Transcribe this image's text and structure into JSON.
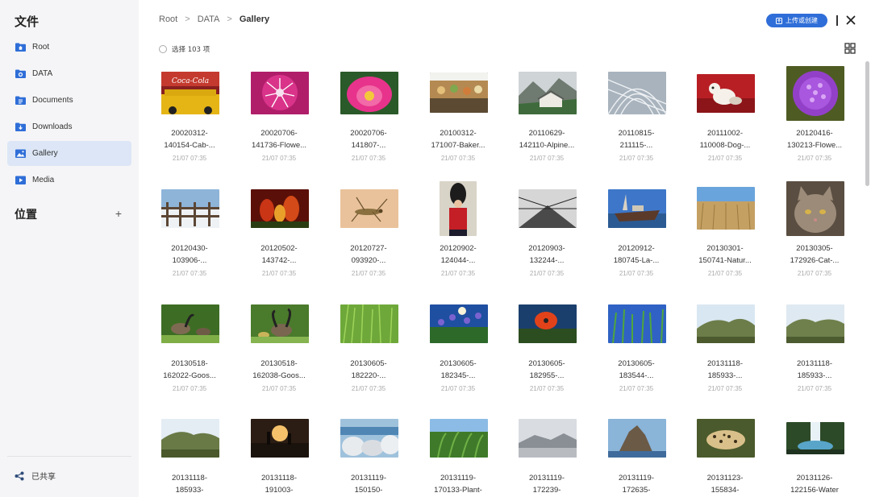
{
  "sidebar": {
    "title": "文件",
    "items": [
      {
        "label": "Root",
        "icon": "home-folder-icon"
      },
      {
        "label": "DATA",
        "icon": "data-folder-icon"
      },
      {
        "label": "Documents",
        "icon": "documents-folder-icon"
      },
      {
        "label": "Downloads",
        "icon": "downloads-folder-icon"
      },
      {
        "label": "Gallery",
        "icon": "gallery-icon"
      },
      {
        "label": "Media",
        "icon": "media-icon"
      }
    ],
    "location_title": "位置",
    "add_label": "+",
    "shared_label": "已共享"
  },
  "breadcrumb": {
    "items": [
      "Root",
      "DATA",
      "Gallery"
    ],
    "separator": ">"
  },
  "toolbar": {
    "upload_label": "上传或创建",
    "close_label": "close"
  },
  "select_all_label": "选择 103 项",
  "colors": {
    "accent": "#2f6ed8",
    "sidebar_bg": "#f5f5f7",
    "active_bg": "#dce6f6"
  },
  "items": [
    {
      "l1": "20020312-",
      "l2": "140154-Cab-...",
      "date": "21/07 07:35",
      "thumb": "taxi"
    },
    {
      "l1": "20020706-",
      "l2": "141736-Flowe...",
      "date": "21/07 07:35",
      "thumb": "pink-flower"
    },
    {
      "l1": "20020706-",
      "l2": "141807-...",
      "date": "21/07 07:35",
      "thumb": "lotus"
    },
    {
      "l1": "20100312-",
      "l2": "171007-Baker...",
      "date": "21/07 07:35",
      "thumb": "bakery"
    },
    {
      "l1": "20110629-",
      "l2": "142110-Alpine...",
      "date": "21/07 07:35",
      "thumb": "alpine"
    },
    {
      "l1": "20110815-",
      "l2": "211115-...",
      "date": "21/07 07:35",
      "thumb": "architecture"
    },
    {
      "l1": "20111002-",
      "l2": "110008-Dog-...",
      "date": "21/07 07:35",
      "thumb": "dog"
    },
    {
      "l1": "20120416-",
      "l2": "130213-Flowe...",
      "date": "21/07 07:35",
      "thumb": "purple-flower"
    },
    {
      "l1": "20120430-",
      "l2": "103906-...",
      "date": "21/07 07:35",
      "thumb": "snow-fence"
    },
    {
      "l1": "20120502-",
      "l2": "143742-...",
      "date": "21/07 07:35",
      "thumb": "tulips"
    },
    {
      "l1": "20120727-",
      "l2": "093920-...",
      "date": "21/07 07:35",
      "thumb": "grasshopper"
    },
    {
      "l1": "20120902-",
      "l2": "124044-...",
      "date": "21/07 07:35",
      "thumb": "guard"
    },
    {
      "l1": "20120903-",
      "l2": "132244-...",
      "date": "21/07 07:35",
      "thumb": "bridge"
    },
    {
      "l1": "20120912-",
      "l2": "180745-La-...",
      "date": "21/07 07:35",
      "thumb": "boat"
    },
    {
      "l1": "20130301-",
      "l2": "150741-Natur...",
      "date": "21/07 07:35",
      "thumb": "field"
    },
    {
      "l1": "20130305-",
      "l2": "172926-Cat-...",
      "date": "21/07 07:35",
      "thumb": "cat"
    },
    {
      "l1": "20130518-",
      "l2": "162022-Goos...",
      "date": "21/07 07:35",
      "thumb": "goose1"
    },
    {
      "l1": "20130518-",
      "l2": "162038-Goos...",
      "date": "21/07 07:35",
      "thumb": "goose2"
    },
    {
      "l1": "20130605-",
      "l2": "182220-...",
      "date": "21/07 07:35",
      "thumb": "grass"
    },
    {
      "l1": "20130605-",
      "l2": "182345-...",
      "date": "21/07 07:35",
      "thumb": "bluebells"
    },
    {
      "l1": "20130605-",
      "l2": "182955-...",
      "date": "21/07 07:35",
      "thumb": "poppy"
    },
    {
      "l1": "20130605-",
      "l2": "183544-...",
      "date": "21/07 07:35",
      "thumb": "reeds"
    },
    {
      "l1": "20131118-",
      "l2": "185933-...",
      "date": "21/07 07:35",
      "thumb": "hill1"
    },
    {
      "l1": "20131118-",
      "l2": "185933-...",
      "date": "21/07 07:35",
      "thumb": "hill2"
    },
    {
      "l1": "20131118-",
      "l2": "185933-",
      "date": "",
      "thumb": "hill3"
    },
    {
      "l1": "20131118-",
      "l2": "191003-",
      "date": "",
      "thumb": "sunset"
    },
    {
      "l1": "20131119-",
      "l2": "150150-",
      "date": "",
      "thumb": "rocks"
    },
    {
      "l1": "20131119-",
      "l2": "170133-Plant-",
      "date": "",
      "thumb": "plant"
    },
    {
      "l1": "20131119-",
      "l2": "172239-",
      "date": "",
      "thumb": "mountain"
    },
    {
      "l1": "20131119-",
      "l2": "172635-",
      "date": "",
      "thumb": "cliff"
    },
    {
      "l1": "20131123-",
      "l2": "155834-",
      "date": "",
      "thumb": "leopard"
    },
    {
      "l1": "20131126-",
      "l2": "122156-Water",
      "date": "",
      "thumb": "waterfall"
    }
  ]
}
